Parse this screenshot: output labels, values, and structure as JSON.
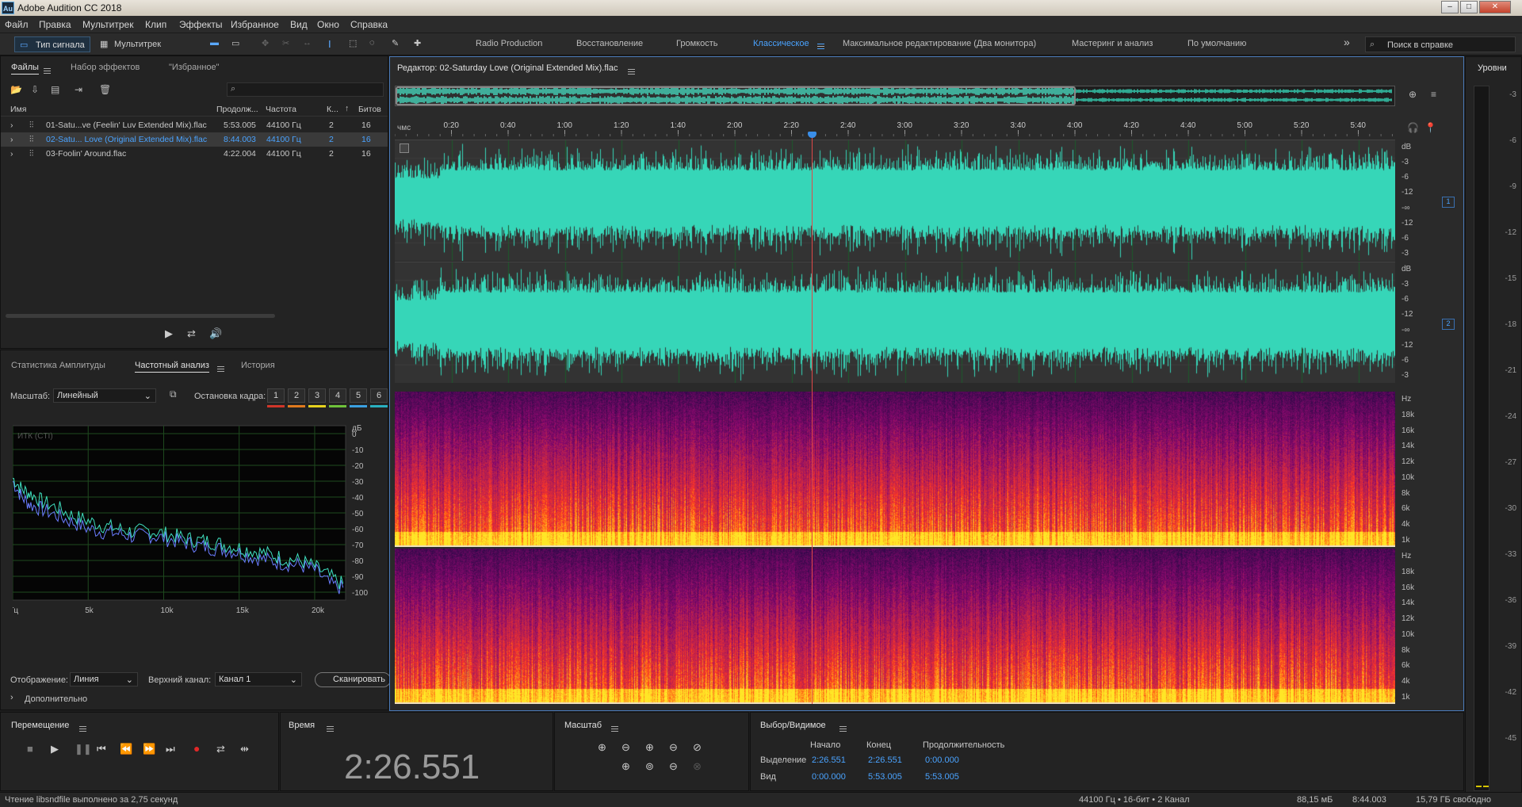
{
  "window": {
    "title": "Adobe Audition CC 2018",
    "logo": "Au"
  },
  "menu": [
    "Файл",
    "Правка",
    "Мультитрек",
    "Клип",
    "Эффекты",
    "Избранное",
    "Вид",
    "Окно",
    "Справка"
  ],
  "toolbar": {
    "waveform_label": "Тип сигнала",
    "multitrack_label": "Мультитрек",
    "workspaces": [
      "Radio Production",
      "Восстановление",
      "Громкость",
      "Классическое",
      "Максимальное редактирование (Два монитора)",
      "Мастеринг и анализ",
      "По умолчанию"
    ],
    "active_workspace": "Классическое",
    "search_placeholder": "Поиск в справке"
  },
  "files_panel": {
    "tabs": [
      "Файлы",
      "Набор эффектов",
      "\"Избранное\""
    ],
    "columns": [
      "Имя",
      "Продолж...",
      "Частота",
      "К...",
      "Битов"
    ],
    "rows": [
      {
        "name": "01-Satu...ve (Feelin' Luv Extended Mix).flac",
        "duration": "5:53.005",
        "rate": "44100 Гц",
        "ch": "2",
        "bits": "16",
        "selected": false
      },
      {
        "name": "02-Satu... Love (Original Extended Mix).flac",
        "duration": "8:44.003",
        "rate": "44100 Гц",
        "ch": "2",
        "bits": "16",
        "selected": true
      },
      {
        "name": "03-Foolin' Around.flac",
        "duration": "4:22.004",
        "rate": "44100 Гц",
        "ch": "2",
        "bits": "16",
        "selected": false
      }
    ]
  },
  "analysis_panel": {
    "tabs": [
      "Статистика Амплитуды",
      "Частотный анализ",
      "История"
    ],
    "scale_label": "Масштаб:",
    "scale_value": "Линейный",
    "freeze_label": "Остановка кадра:",
    "freeze_buttons": [
      "1",
      "2",
      "3",
      "4",
      "5",
      "6"
    ],
    "freeze_colors": [
      "#d0362a",
      "#e07a1e",
      "#e6d21e",
      "#6fc23a",
      "#3aa0e0",
      "#2ab0c0"
    ],
    "graph_label": "ИТК (CTI)",
    "db_unit": "дБ",
    "display_label": "Отображение:",
    "display_value": "Линия",
    "channel_label": "Верхний канал:",
    "channel_value": "Канал 1",
    "scan_button": "Сканировать",
    "advanced_label": "Дополнительно"
  },
  "chart_data": {
    "type": "line",
    "title": "",
    "xlabel": "",
    "ylabel": "дБ",
    "x_ticks": [
      "Гц",
      "5k",
      "10k",
      "15k",
      "20k"
    ],
    "y_ticks": [
      "0",
      "-10",
      "-20",
      "-30",
      "-40",
      "-50",
      "-60",
      "-70",
      "-80",
      "-90",
      "-100"
    ],
    "xlim": [
      0,
      22050
    ],
    "ylim": [
      -105,
      5
    ],
    "series": [
      {
        "color": "#6a7cff",
        "x": [
          0,
          600,
          1200,
          2000,
          3000,
          4000,
          5000,
          6000,
          7000,
          8000,
          9000,
          10000,
          11000,
          12000,
          13000,
          14000,
          15000,
          16000,
          17000,
          18000,
          19000,
          20000,
          21000,
          22000
        ],
        "values": [
          -30,
          -40,
          -45,
          -48,
          -52,
          -56,
          -60,
          -62,
          -63,
          -65,
          -64,
          -66,
          -68,
          -70,
          -72,
          -73,
          -75,
          -78,
          -80,
          -82,
          -83,
          -86,
          -95,
          -98
        ]
      },
      {
        "color": "#3fe0c0",
        "x": [
          0,
          600,
          1200,
          2000,
          3000,
          4000,
          5000,
          6000,
          7000,
          8000,
          9000,
          10000,
          11000,
          12000,
          13000,
          14000,
          15000,
          16000,
          17000,
          18000,
          19000,
          20000,
          21000,
          22000
        ],
        "values": [
          -28,
          -35,
          -38,
          -43,
          -47,
          -52,
          -55,
          -58,
          -60,
          -62,
          -61,
          -63,
          -65,
          -67,
          -68,
          -70,
          -72,
          -74,
          -76,
          -79,
          -80,
          -84,
          -90,
          -96
        ]
      }
    ]
  },
  "editor": {
    "title": "Редактор: 02-Saturday Love (Original Extended Mix).flac",
    "time_unit": "чмс",
    "ruler": [
      "0:20",
      "0:40",
      "1:00",
      "1:20",
      "1:40",
      "2:00",
      "2:20",
      "2:40",
      "3:00",
      "3:20",
      "3:40",
      "4:00",
      "4:20",
      "4:40",
      "5:00",
      "5:20",
      "5:40"
    ],
    "db_scale": [
      "dB",
      "-3",
      "-6",
      "-12",
      "-∞",
      "-12",
      "-6",
      "-3"
    ],
    "hz_scale": [
      "Hz",
      "18k",
      "16k",
      "14k",
      "12k",
      "10k",
      "8k",
      "6k",
      "4k",
      "1k"
    ],
    "channels": [
      "1",
      "2"
    ],
    "waveform_color": "#36d6b8"
  },
  "levels_panel": {
    "title": "Уровни",
    "scale": [
      "-3",
      "-6",
      "-9",
      "-12",
      "-15",
      "-18",
      "-21",
      "-24",
      "-27",
      "-30",
      "-33",
      "-36",
      "-39",
      "-42",
      "-45"
    ]
  },
  "transport": {
    "title": "Перемещение"
  },
  "time": {
    "title": "Время",
    "value": "2:26.551"
  },
  "zoom": {
    "title": "Масштаб"
  },
  "selection": {
    "title": "Выбор/Видимое",
    "start": "Начало",
    "end": "Конец",
    "duration": "Продолжительность",
    "sel_label": "Выделение",
    "sel_start": "2:26.551",
    "sel_end": "2:26.551",
    "sel_dur": "0:00.000",
    "view_label": "Вид",
    "view_start": "0:00.000",
    "view_end": "5:53.005",
    "view_dur": "5:53.005"
  },
  "status": {
    "message": "Чтение libsndfile выполнено за 2,75 секунд",
    "format": "44100 Гц • 16-бит • 2 Канал",
    "size": "88,15 мБ",
    "duration": "8:44.003",
    "free": "15,79 ГБ свободно"
  }
}
